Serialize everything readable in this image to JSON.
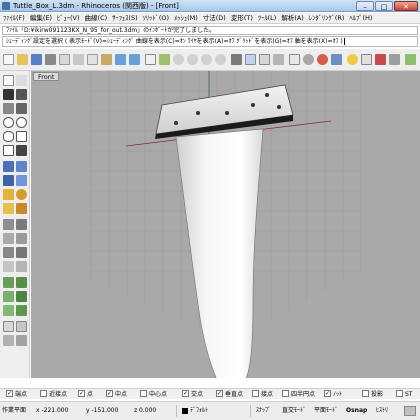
{
  "window": {
    "title": "Tuttle_Box_L.3dm - Rhinoceros (関西版) - [Front]"
  },
  "menu": [
    "ﾌｧｲﾙ(F)",
    "編集(E)",
    "ﾋﾞｭｰ(V)",
    "曲線(C)",
    "ｻｰﾌｪｽ(S)",
    "ｿﾘｯﾄﾞ(O)",
    "ﾒｯｼｭ(M)",
    "寸法(D)",
    "変形(T)",
    "ﾂｰﾙ(L)",
    "解析(A)",
    "ﾚﾝﾀﾞﾘﾝｸﾞ(R)",
    "ﾍﾙﾌﾟ(H)"
  ],
  "command": {
    "history": "ﾌｧｲﾙ「D:¥ikirw091123KX_N_95_for_out.3dm」のｲﾝﾎﾟｰﾄが完了しました。",
    "prompt": "ｼｪｰﾃﾞｨﾝｸﾞ設定を選択 ( 表示ﾓｰﾄﾞ(V)=ｼｪｰﾃﾞｨﾝｸﾞ 曲線を表示(C)=ｵﾝ ﾜｲﾔを表示(A)=ｵﾌ ｸﾞﾘｯﾄﾞを表示(G)=ｵﾌ 軸を表示(X)=ｵﾌ )"
  },
  "viewport": {
    "label": "Front"
  },
  "osnap": [
    {
      "label": "端点",
      "checked": true
    },
    {
      "label": "近接点",
      "checked": false
    },
    {
      "label": "点",
      "checked": true
    },
    {
      "label": "中点",
      "checked": true
    },
    {
      "label": "中心点",
      "checked": false
    },
    {
      "label": "交点",
      "checked": true
    },
    {
      "label": "垂直点",
      "checked": true
    },
    {
      "label": "接点",
      "checked": false
    },
    {
      "label": "四半円点",
      "checked": false
    },
    {
      "label": "ﾉｯﾄ",
      "checked": true
    },
    {
      "label": "投影",
      "checked": false
    },
    {
      "label": "ST",
      "checked": false
    }
  ],
  "status": {
    "cplane": "作業平面",
    "x": "x -221.000",
    "y": "y -151.000",
    "z": "z 0.000",
    "layer": "ﾃﾞﾌｫﾙﾄ",
    "snap": "ｽﾅｯﾌﾟ",
    "ortho": "直交ﾓｰﾄﾞ",
    "planar": "平面ﾓｰﾄﾞ",
    "osnap": "Osnap",
    "history": "ﾋｽﾄﾘ"
  },
  "colors": {
    "viewport_bg": "#a9a9a9",
    "titlebar": "#b9d4ee",
    "fin_surface": "#f2f2f2",
    "mount_plate": "#e8e8e8"
  }
}
